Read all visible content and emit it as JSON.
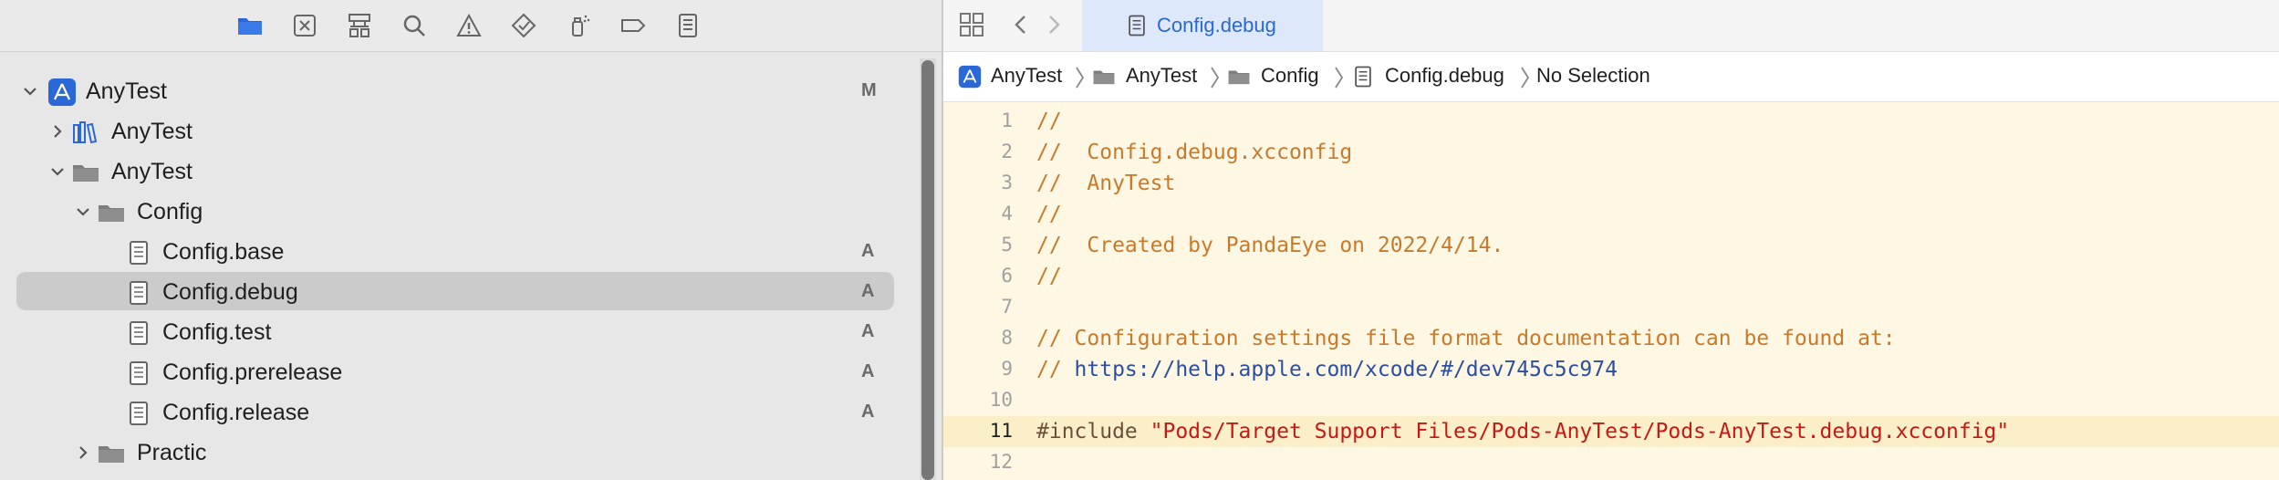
{
  "colors": {
    "accent": "#2a68d8",
    "selection": "#cbcbcb",
    "editor_bg": "#fdf7e3",
    "comment": "#c87a2c",
    "url": "#2c4ea3",
    "string": "#c41a16"
  },
  "navigator": {
    "toolbar_icons": [
      "folder-icon",
      "source-control-icon",
      "hierarchy-icon",
      "search-icon",
      "warning-icon",
      "test-diamond-icon",
      "debug-spray-icon",
      "breakpoint-icon",
      "report-list-icon"
    ],
    "tree": [
      {
        "label": "AnyTest",
        "icon": "app-project-icon",
        "status": "M",
        "expanded": true
      },
      {
        "label": "AnyTest",
        "icon": "library-icon",
        "status": "",
        "expanded": false
      },
      {
        "label": "AnyTest",
        "icon": "folder-icon",
        "status": "",
        "expanded": true
      },
      {
        "label": "Config",
        "icon": "folder-icon",
        "status": "",
        "expanded": true
      },
      {
        "label": "Config.base",
        "icon": "document-icon",
        "status": "A"
      },
      {
        "label": "Config.debug",
        "icon": "document-icon",
        "status": "A",
        "selected": true
      },
      {
        "label": "Config.test",
        "icon": "document-icon",
        "status": "A"
      },
      {
        "label": "Config.prerelease",
        "icon": "document-icon",
        "status": "A"
      },
      {
        "label": "Config.release",
        "icon": "document-icon",
        "status": "A"
      },
      {
        "label": "Practic",
        "icon": "folder-icon",
        "status": "",
        "expanded": false
      }
    ]
  },
  "editor": {
    "tab": {
      "label": "Config.debug"
    },
    "breadcrumbs": [
      "AnyTest",
      "AnyTest",
      "Config",
      "Config.debug",
      "No Selection"
    ],
    "current_line": 11,
    "lines": [
      {
        "n": "1",
        "text": "//"
      },
      {
        "n": "2",
        "text": "//  Config.debug.xcconfig"
      },
      {
        "n": "3",
        "text": "//  AnyTest"
      },
      {
        "n": "4",
        "text": "//"
      },
      {
        "n": "5",
        "text": "//  Created by PandaEye on 2022/4/14."
      },
      {
        "n": "6",
        "text": "//"
      },
      {
        "n": "7",
        "text": ""
      },
      {
        "n": "8",
        "text": "// Configuration settings file format documentation can be found at:"
      },
      {
        "n": "9",
        "prefix": "// ",
        "url": "https://help.apple.com/xcode/#/dev745c5c974"
      },
      {
        "n": "10",
        "text": ""
      },
      {
        "n": "11",
        "directive": "#include ",
        "string": "\"Pods/Target Support Files/Pods-AnyTest/Pods-AnyTest.debug.xcconfig\""
      },
      {
        "n": "12",
        "text": ""
      }
    ]
  }
}
